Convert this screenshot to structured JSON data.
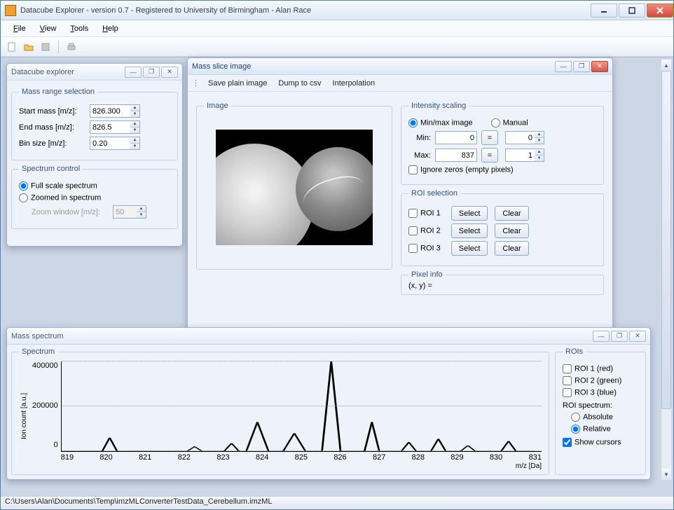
{
  "app": {
    "title": "Datacube Explorer - version 0.7 - Registered to University of Birmingham - Alan Race"
  },
  "menubar": {
    "items": [
      "File",
      "View",
      "Tools",
      "Help"
    ]
  },
  "statusbar": {
    "path": "C:\\Users\\Alan\\Documents\\Temp\\imzMLConverterTestData_Cerebellum.imzML"
  },
  "explorer": {
    "title": "Datacube explorer",
    "mass_range_legend": "Mass range selection",
    "start_mass_label": "Start mass [m/z]:",
    "start_mass": "826.300",
    "end_mass_label": "End mass [m/z]:",
    "end_mass": "826.5",
    "bin_size_label": "Bin size [m/z]:",
    "bin_size": "0.20",
    "spectrum_control_legend": "Spectrum control",
    "full_scale_label": "Full scale spectrum",
    "zoomed_label": "Zoomed in spectrum",
    "zoom_window_label": "Zoom window [m/z]:",
    "zoom_window": "50"
  },
  "slice": {
    "title": "Mass slice image",
    "toolbar": {
      "save": "Save plain image",
      "dump": "Dump to csv",
      "interp": "Interpolation"
    },
    "image_legend": "Image",
    "intensity_legend": "Intensity scaling",
    "minmax_label": "Min/max image",
    "manual_label": "Manual",
    "min_label": "Min:",
    "min_readout": "0",
    "min_manual": "0",
    "max_label": "Max:",
    "max_readout": "837",
    "max_manual": "1",
    "ignore_zeros_label": "Ignore zeros (empty pixels)",
    "roi_legend": "ROI selection",
    "roi1": "ROI 1",
    "roi2": "ROI 2",
    "roi3": "ROI 3",
    "select_btn": "Select",
    "clear_btn": "Clear",
    "pixel_info_legend": "Pixel info",
    "pixel_info_value": "(x, y) ="
  },
  "spectrum": {
    "title": "Mass spectrum",
    "spectrum_legend": "Spectrum",
    "rois_legend": "ROIs",
    "roi1": "ROI 1 (red)",
    "roi2": "ROI 2 (green)",
    "roi3": "ROI 3 (blue)",
    "roi_spectrum_label": "ROI spectrum:",
    "absolute": "Absolute",
    "relative": "Relative",
    "show_cursors": "Show cursors",
    "ylabel": "Ion count [a.u.]",
    "xlabel": "m/z [Da]"
  },
  "chart_data": {
    "type": "line",
    "title": "",
    "xlabel": "m/z [Da]",
    "ylabel": "Ion count [a.u.]",
    "ylim": [
      0,
      400000
    ],
    "xlim": [
      819,
      832
    ],
    "yticks": [
      0,
      200000,
      400000
    ],
    "xticks": [
      819,
      820,
      821,
      822,
      823,
      824,
      825,
      826,
      827,
      828,
      829,
      830,
      831
    ],
    "x": [
      819.0,
      820.1,
      820.3,
      820.5,
      821.5,
      822.4,
      822.6,
      822.8,
      823.4,
      823.6,
      823.8,
      824.0,
      824.3,
      824.6,
      825.0,
      825.3,
      825.6,
      826.05,
      826.3,
      826.55,
      827.2,
      827.4,
      827.6,
      828.2,
      828.4,
      828.6,
      829.0,
      829.2,
      829.4,
      829.8,
      830.0,
      830.2,
      830.9,
      831.1,
      831.3,
      831.8
    ],
    "values": [
      0,
      0,
      60000,
      0,
      0,
      0,
      20000,
      0,
      0,
      35000,
      0,
      0,
      130000,
      0,
      0,
      80000,
      0,
      0,
      400000,
      0,
      0,
      130000,
      0,
      0,
      40000,
      0,
      0,
      55000,
      0,
      0,
      25000,
      0,
      0,
      45000,
      0,
      0
    ]
  }
}
